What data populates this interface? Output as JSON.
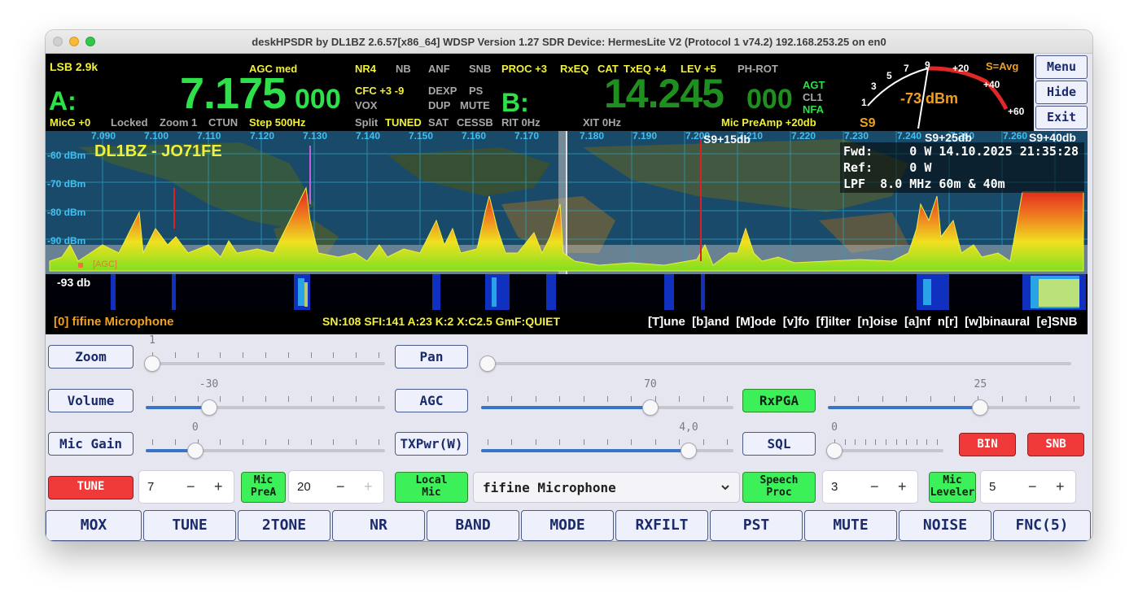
{
  "window": {
    "title": "deskHPSDR by DL1BZ 2.6.57[x86_64] WDSP Version 1.27 SDR Device: HermesLite V2 (Protocol 1 v74.2) 192.168.253.25 on en0"
  },
  "vfo": {
    "mode_filter": "LSB 2.9k",
    "agc": "AGC med",
    "vfo_a_label": "A:",
    "vfo_a_freq_main": "7.175",
    "vfo_a_freq_small": "000",
    "vfo_b_label": "B:",
    "vfo_b_freq_main": "14.245",
    "vfo_b_freq_small": "000",
    "mic_gain": "MicG +0",
    "locked": "Locked",
    "zoom": "Zoom 1",
    "ctun": "CTUN",
    "step": "Step 500Hz",
    "nr4": "NR4",
    "nb": "NB",
    "anf": "ANF",
    "snb": "SNB",
    "proc": "PROC +3",
    "rxeq": "RxEQ",
    "cat": "CAT",
    "txeq": "TxEQ +4",
    "lev": "LEV +5",
    "phrot": "PH-ROT",
    "cfc": "CFC +3 -9",
    "dexp": "DEXP",
    "ps": "PS",
    "vox": "VOX",
    "dup": "DUP",
    "mute": "MUTE",
    "split": "Split",
    "tuned": "TUNED",
    "sat": "SAT",
    "cessb": "CESSB",
    "rit": "RIT 0Hz",
    "xit": "XIT 0Hz",
    "mic_preamp": "Mic PreAmp +20db",
    "agt": "AGT",
    "cl1": "CL1",
    "nfa": "NFA",
    "s_avg": "S=Avg",
    "s_meter_reading": "-73 dBm",
    "s_unit": "S9",
    "meter_scale": [
      "1",
      "3",
      "5",
      "7",
      "9",
      "+20",
      "+40",
      "+60"
    ]
  },
  "menu": {
    "menu": "Menu",
    "hide": "Hide",
    "exit": "Exit"
  },
  "panadapter": {
    "freq_ticks": [
      "7.090",
      "7.100",
      "7.110",
      "7.120",
      "7.130",
      "7.140",
      "7.150",
      "7.160",
      "7.170",
      "7.180",
      "7.190",
      "7.200",
      "7.210",
      "7.220",
      "7.230",
      "7.240",
      "7.250",
      "7.260"
    ],
    "dbm_ticks": [
      "-60 dBm",
      "-70 dBm",
      "-80 dBm",
      "-90 dBm"
    ],
    "callsign": "DL1BZ - JO71FE",
    "s9_15": "S9+15db",
    "s9_25": "S9+25db",
    "s9_40": "S9+40db",
    "fwd": "Fwd:     0 W 14.10.2025 21:35:28",
    "ref": "Ref:     0 W",
    "lpf": "LPF  8.0 MHz 60m & 40m",
    "agc_marker": "[AGC]",
    "noise_floor": "-93 db"
  },
  "infobar": {
    "audio_device": "[0] fifine Microphone",
    "solar": "SN:108 SFI:141 A:23 K:2 X:C2.5 GmF:QUIET",
    "shortcuts": "[T]une  [b]and  [M]ode  [v]fo  [f]ilter  [n]oise  [a]nf  n[r]  [w]binaural  [e]SNB"
  },
  "controls": {
    "zoom_label": "Zoom",
    "zoom_value": "1",
    "pan_label": "Pan",
    "volume_label": "Volume",
    "volume_value": "-30",
    "agc_label": "AGC",
    "agc_value": "70",
    "rxpga_label": "RxPGA",
    "rxpga_value": "25",
    "micgain_label": "Mic Gain",
    "micgain_value": "0",
    "txpwr_label": "TXPwr(W)",
    "txpwr_value": "4,0",
    "sql_label": "SQL",
    "sql_value": "0",
    "bin_label": "BIN",
    "snb_label": "SNB",
    "tune_label": "TUNE",
    "tune_spin": "7",
    "mic_prea_label1": "Mic",
    "mic_prea_label2": "PreA",
    "mic_prea_spin": "20",
    "local_mic_label1": "Local",
    "local_mic_label2": "Mic",
    "mic_device": "fifine Microphone",
    "speech_proc_label1": "Speech",
    "speech_proc_label2": "Proc",
    "speech_spin": "3",
    "mic_leveler_label1": "Mic",
    "mic_leveler_label2": "Leveler",
    "leveler_spin": "5",
    "minus": "−",
    "plus": "+"
  },
  "levels": {
    "zoom": 0.0,
    "pan": 0.0,
    "volume": 0.25,
    "agc": 0.68,
    "rxpga": 0.61,
    "micgain": 0.19,
    "txpwr": 0.84,
    "sql": 0.0
  },
  "bottom_buttons": [
    "MOX",
    "TUNE",
    "2TONE",
    "NR",
    "BAND",
    "MODE",
    "RXFILT",
    "PST",
    "MUTE",
    "NOISE",
    "FNC(5)"
  ],
  "colors": {
    "accent_green": "#3cf05a",
    "accent_red": "#f03a3a",
    "vfo_yellow": "#f0f03c",
    "vfo_green": "#2ee04a"
  }
}
